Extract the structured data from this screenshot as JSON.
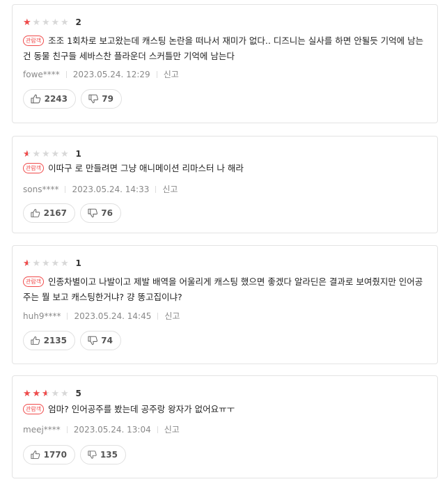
{
  "reviews": [
    {
      "rating": 2,
      "score_label": "2",
      "badge": "관람객",
      "text": "조조 1회차로 보고왔는데 캐스팅 논란을 떠나서 재미가 없다.. 디즈니는 실사를 하면 안될듯 기억에 남는건 동물 친구들 세바스찬 플라운더 스커틀만 기억에 남는다",
      "author": "fowe****",
      "datetime": "2023.05.24. 12:29",
      "report_label": "신고",
      "likes": "2243",
      "dislikes": "79"
    },
    {
      "rating": 1,
      "score_label": "1",
      "badge": "관람객",
      "text": "이따구 로 만들려면 그냥 애니메이션 리마스터 나 해라",
      "author": "sons****",
      "datetime": "2023.05.24. 14:33",
      "report_label": "신고",
      "likes": "2167",
      "dislikes": "76"
    },
    {
      "rating": 1,
      "score_label": "1",
      "badge": "관람객",
      "text": "인종차별이고 나발이고 제발 배역을 어울리게 캐스팅 했으면 좋겠다 알라딘은 결과로 보여줬지만 인어공주는 뭘 보고 캐스팅한거냐? 걍 똥고집이냐?",
      "author": "huh9****",
      "datetime": "2023.05.24. 14:45",
      "report_label": "신고",
      "likes": "2135",
      "dislikes": "74"
    },
    {
      "rating": 5,
      "score_label": "5",
      "badge": "관람객",
      "text": "엄마? 인어공주를 봤는데 공주랑 왕자가 없어요ㅠㅜ",
      "author": "meej****",
      "datetime": "2023.05.24. 13:04",
      "report_label": "신고",
      "likes": "1770",
      "dislikes": "135"
    }
  ],
  "colors": {
    "accent": "#f04a4a",
    "star_empty": "#d8d8d8"
  }
}
